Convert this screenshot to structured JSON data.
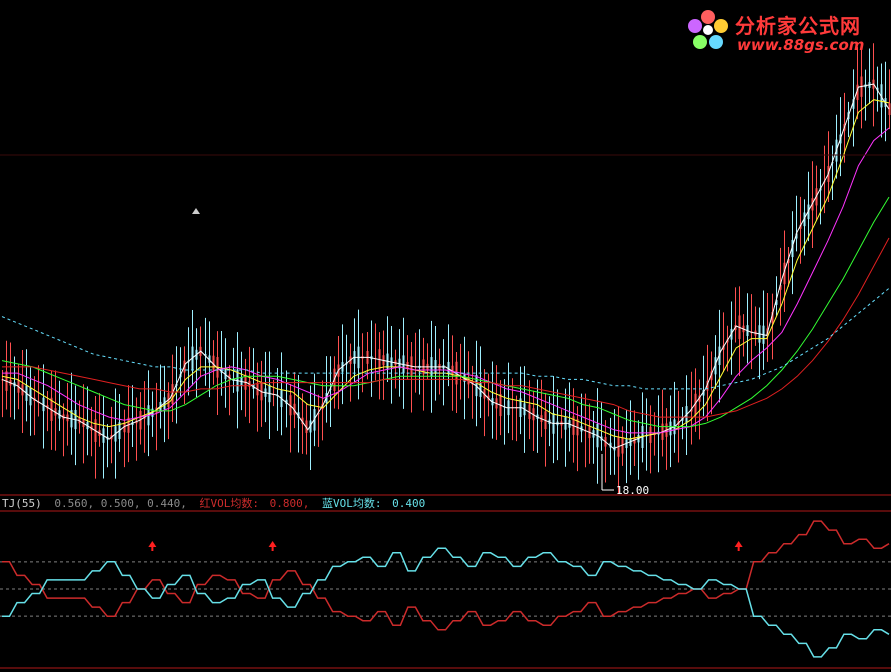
{
  "watermark": {
    "title": "分析家公式网",
    "url": "www.88gs.com"
  },
  "indicator": {
    "name": "TJ(55)",
    "values_text": "0.560, 0.500, 0.440,",
    "red_label": "红VOL均数:",
    "red_value": "0.800,",
    "blue_label": "蓝VOL均数:",
    "blue_value": "0.400"
  },
  "colors": {
    "background": "#000000",
    "up_candle": "#ff5050",
    "down_candle": "#9ff0ff",
    "ma_white": "#ffffff",
    "ma_yellow": "#ffff33",
    "ma_magenta": "#ff33ff",
    "ma_green": "#33ff33",
    "ma_red": "#e02020",
    "ma_cyan_dashed": "#66e0ff",
    "red_vol_line": "#cc2b2b",
    "blue_vol_line": "#66e0e8",
    "signal_arrow": "#ff2020",
    "panel_border": "#b01818"
  },
  "chart_data": [
    {
      "type": "candlestick",
      "title": "",
      "annotations": [
        {
          "text": "18.00",
          "type": "low-price-marker"
        }
      ],
      "series": [
        {
          "name": "",
          "style": "white-ma",
          "y": [
            20.2,
            20.0,
            19.6,
            19.3,
            19.0,
            18.9,
            18.6,
            18.3,
            18.7,
            18.9,
            19.2,
            19.6,
            20.7,
            21.1,
            20.6,
            20.2,
            20.1,
            19.8,
            19.7,
            19.3,
            18.6,
            19.4,
            20.5,
            20.9,
            20.9,
            20.8,
            20.7,
            20.6,
            20.6,
            20.6,
            20.3,
            20.0,
            19.5,
            19.3,
            19.3,
            19.0,
            18.8,
            18.8,
            18.6,
            18.4,
            18.0,
            18.2,
            18.4,
            18.5,
            18.7,
            19.2,
            19.9,
            21.1,
            21.9,
            21.7,
            21.6,
            23.4,
            24.9,
            25.8,
            26.7,
            28.1,
            29.5,
            29.6,
            28.8
          ]
        },
        {
          "name": "",
          "style": "yellow-ma",
          "y": [
            20.3,
            20.2,
            19.9,
            19.6,
            19.3,
            19.0,
            18.8,
            18.7,
            18.8,
            19.0,
            19.2,
            19.5,
            20.2,
            20.6,
            20.6,
            20.5,
            20.3,
            20.1,
            19.9,
            19.8,
            19.4,
            19.3,
            19.8,
            20.3,
            20.5,
            20.6,
            20.6,
            20.5,
            20.4,
            20.4,
            20.3,
            20.1,
            19.8,
            19.6,
            19.5,
            19.4,
            19.1,
            19.0,
            18.8,
            18.6,
            18.4,
            18.3,
            18.4,
            18.5,
            18.6,
            18.9,
            19.4,
            20.3,
            21.2,
            21.5,
            21.5,
            22.6,
            24.0,
            25.0,
            26.0,
            27.3,
            28.7,
            29.1,
            29.0
          ]
        },
        {
          "name": "",
          "style": "magenta-ma",
          "y": [
            20.4,
            20.4,
            20.2,
            20.0,
            19.7,
            19.4,
            19.2,
            19.0,
            18.9,
            19.0,
            19.1,
            19.3,
            19.8,
            20.3,
            20.5,
            20.6,
            20.5,
            20.3,
            20.2,
            20.0,
            19.8,
            19.6,
            19.8,
            20.1,
            20.4,
            20.5,
            20.6,
            20.5,
            20.5,
            20.5,
            20.4,
            20.3,
            20.1,
            19.9,
            19.8,
            19.6,
            19.4,
            19.2,
            19.0,
            18.8,
            18.6,
            18.5,
            18.5,
            18.5,
            18.6,
            18.7,
            19.0,
            19.6,
            20.3,
            20.8,
            21.2,
            21.7,
            22.6,
            23.6,
            24.6,
            25.7,
            27.0,
            27.8,
            28.2
          ]
        },
        {
          "name": "",
          "style": "green-ma",
          "y": [
            20.8,
            20.7,
            20.6,
            20.4,
            20.2,
            20.0,
            19.8,
            19.6,
            19.4,
            19.3,
            19.2,
            19.2,
            19.4,
            19.7,
            20.0,
            20.2,
            20.3,
            20.3,
            20.3,
            20.2,
            20.1,
            20.0,
            20.0,
            20.0,
            20.1,
            20.2,
            20.3,
            20.3,
            20.3,
            20.3,
            20.3,
            20.2,
            20.1,
            20.0,
            19.9,
            19.8,
            19.7,
            19.6,
            19.4,
            19.3,
            19.1,
            18.9,
            18.8,
            18.7,
            18.7,
            18.7,
            18.8,
            19.0,
            19.3,
            19.6,
            20.0,
            20.5,
            21.1,
            21.8,
            22.6,
            23.4,
            24.3,
            25.2,
            26.0
          ]
        },
        {
          "name": "",
          "style": "red-ma",
          "y": [
            20.6,
            20.6,
            20.6,
            20.5,
            20.4,
            20.3,
            20.2,
            20.1,
            20.0,
            19.9,
            19.9,
            19.8,
            19.8,
            19.9,
            19.9,
            20.0,
            20.0,
            20.1,
            20.1,
            20.1,
            20.1,
            20.1,
            20.1,
            20.1,
            20.1,
            20.2,
            20.2,
            20.2,
            20.2,
            20.2,
            20.2,
            20.1,
            20.1,
            20.0,
            20.0,
            19.9,
            19.8,
            19.7,
            19.6,
            19.5,
            19.4,
            19.2,
            19.1,
            19.0,
            19.0,
            19.0,
            19.0,
            19.1,
            19.2,
            19.4,
            19.6,
            19.9,
            20.3,
            20.8,
            21.4,
            22.1,
            22.9,
            23.8,
            24.7
          ]
        },
        {
          "name": "",
          "style": "cyan-dashed-ma",
          "y": [
            22.2,
            22.0,
            21.8,
            21.6,
            21.4,
            21.2,
            21.0,
            20.9,
            20.8,
            20.7,
            20.6,
            20.6,
            20.5,
            20.5,
            20.5,
            20.5,
            20.5,
            20.4,
            20.4,
            20.4,
            20.4,
            20.4,
            20.4,
            20.4,
            20.4,
            20.4,
            20.4,
            20.4,
            20.4,
            20.4,
            20.4,
            20.4,
            20.4,
            20.4,
            20.4,
            20.3,
            20.3,
            20.2,
            20.2,
            20.1,
            20.0,
            20.0,
            19.9,
            19.9,
            19.9,
            19.9,
            19.9,
            20.0,
            20.1,
            20.2,
            20.4,
            20.6,
            20.9,
            21.2,
            21.5,
            21.9,
            22.3,
            22.7,
            23.1
          ]
        }
      ]
    },
    {
      "type": "line",
      "title": "",
      "levels": [
        0.56,
        0.5,
        0.44
      ],
      "signals": [
        {
          "index": 10
        },
        {
          "index": 18
        },
        {
          "index": 49
        }
      ],
      "series": [
        {
          "name": "红VOL均数",
          "y": [
            0.56,
            0.53,
            0.51,
            0.48,
            0.48,
            0.48,
            0.46,
            0.44,
            0.47,
            0.5,
            0.52,
            0.49,
            0.47,
            0.51,
            0.53,
            0.52,
            0.49,
            0.48,
            0.52,
            0.54,
            0.51,
            0.48,
            0.45,
            0.44,
            0.43,
            0.45,
            0.42,
            0.46,
            0.43,
            0.41,
            0.43,
            0.45,
            0.42,
            0.43,
            0.45,
            0.43,
            0.42,
            0.44,
            0.45,
            0.47,
            0.44,
            0.45,
            0.46,
            0.47,
            0.48,
            0.49,
            0.5,
            0.48,
            0.49,
            0.5,
            0.56,
            0.58,
            0.6,
            0.62,
            0.65,
            0.63,
            0.6,
            0.61,
            0.59,
            0.6
          ]
        },
        {
          "name": "蓝VOL均数",
          "y": [
            0.44,
            0.47,
            0.49,
            0.52,
            0.52,
            0.52,
            0.54,
            0.56,
            0.53,
            0.5,
            0.48,
            0.51,
            0.53,
            0.49,
            0.47,
            0.48,
            0.51,
            0.52,
            0.48,
            0.46,
            0.49,
            0.52,
            0.55,
            0.56,
            0.57,
            0.55,
            0.58,
            0.54,
            0.57,
            0.59,
            0.57,
            0.55,
            0.58,
            0.57,
            0.55,
            0.57,
            0.58,
            0.56,
            0.55,
            0.53,
            0.56,
            0.55,
            0.54,
            0.53,
            0.52,
            0.51,
            0.5,
            0.52,
            0.51,
            0.5,
            0.44,
            0.42,
            0.4,
            0.38,
            0.35,
            0.37,
            0.4,
            0.39,
            0.41,
            0.4
          ]
        }
      ]
    }
  ]
}
